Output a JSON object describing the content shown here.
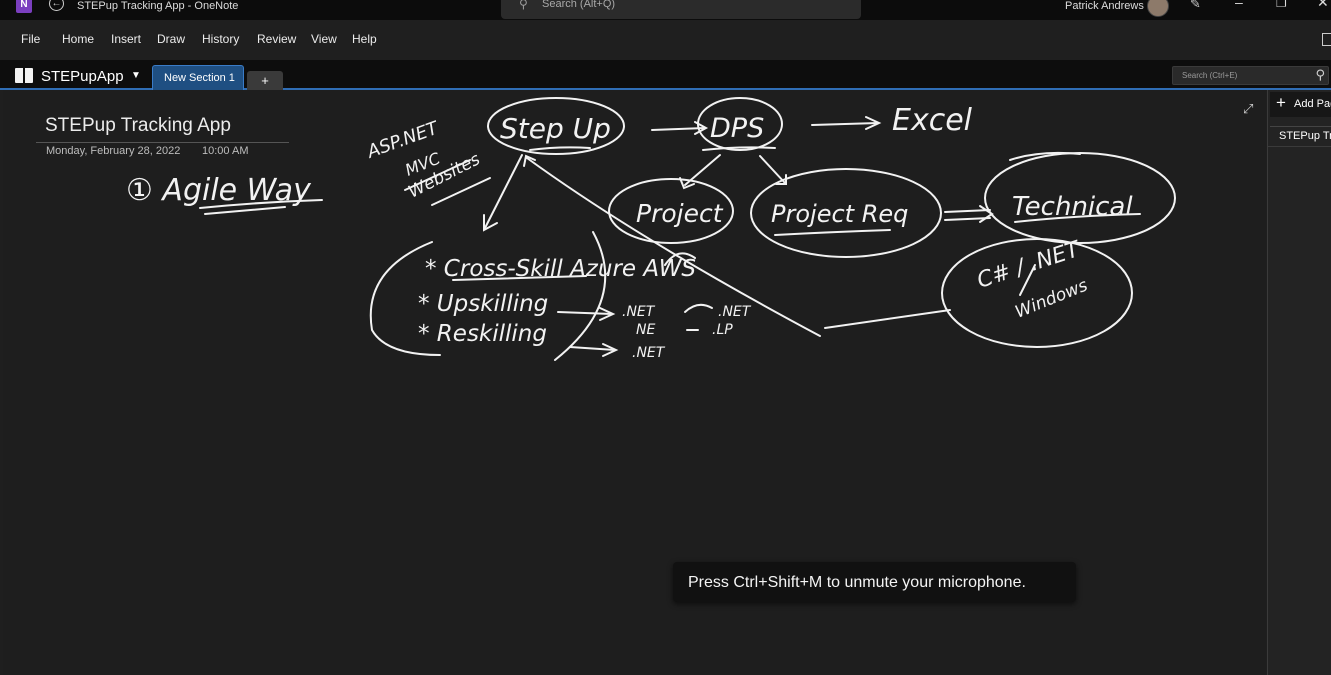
{
  "window": {
    "title": "STEPup Tracking App  -  OneNote",
    "app_icon_letter": "N",
    "search_placeholder": "Search (Alt+Q)",
    "user_name": "Patrick Andrews"
  },
  "menu": [
    "File",
    "Home",
    "Insert",
    "Draw",
    "History",
    "Review",
    "View",
    "Help"
  ],
  "notebook": {
    "name": "STEPupApp",
    "section_tab": "New Section 1",
    "add_section_label": "+",
    "search_placeholder": "Search (Ctrl+E)"
  },
  "page": {
    "title": "STEPup Tracking App",
    "date": "Monday, February 28, 2022",
    "time": "10:00 AM"
  },
  "ink_text": {
    "agile": "① Agile Way",
    "asp_net": "ASP.NET",
    "mvc": "MVC",
    "websites": "Websites",
    "step_up": "Step Up",
    "dps": "DPS",
    "excel": "Excel",
    "project": "Project",
    "project_req": "Project Req",
    "technical": "Technical",
    "csharp_net": "C# / .NET",
    "windows": "Windows",
    "cross_skill": "* Cross-Skill Azure AWS",
    "upskilling": "* Upskilling",
    "reskilling": "* Reskilling",
    "net1": ".NET",
    "net2": ".NET",
    "ne": "NE",
    "lp": ".LP",
    "net3": ".NET"
  },
  "toast": "Press Ctrl+Shift+M to unmute your microphone.",
  "right_pane": {
    "add_page": "Add Page",
    "page_item": "STEPup Tracking App"
  }
}
